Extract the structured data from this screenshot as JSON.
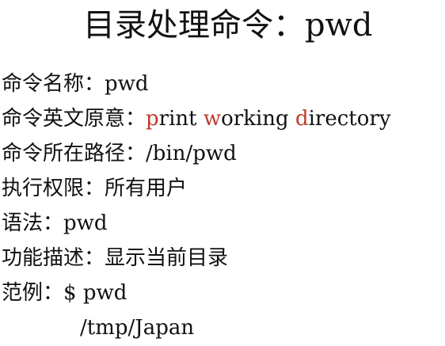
{
  "slide": {
    "title": "目录处理命令：pwd",
    "lines": {
      "name": {
        "label": "命令名称：",
        "value": "pwd"
      },
      "meaning": {
        "label": "命令英文原意：",
        "parts": [
          {
            "hl": "p",
            "rest": "rint "
          },
          {
            "hl": "w",
            "rest": "orking "
          },
          {
            "hl": "d",
            "rest": "irectory"
          }
        ]
      },
      "path": {
        "label": "命令所在路径：",
        "value": "/bin/pwd"
      },
      "perm": {
        "label": "执行权限：",
        "value": "所有用户"
      },
      "syntax": {
        "label": "语法：",
        "value": "pwd"
      },
      "desc": {
        "label": "功能描述：",
        "value": "显示当前目录"
      },
      "example": {
        "label": "范例：",
        "value": "$ pwd",
        "output": "/tmp/Japan"
      }
    },
    "colors": {
      "text": "#111111",
      "highlight": "#c0392b",
      "background": "#ffffff"
    }
  }
}
